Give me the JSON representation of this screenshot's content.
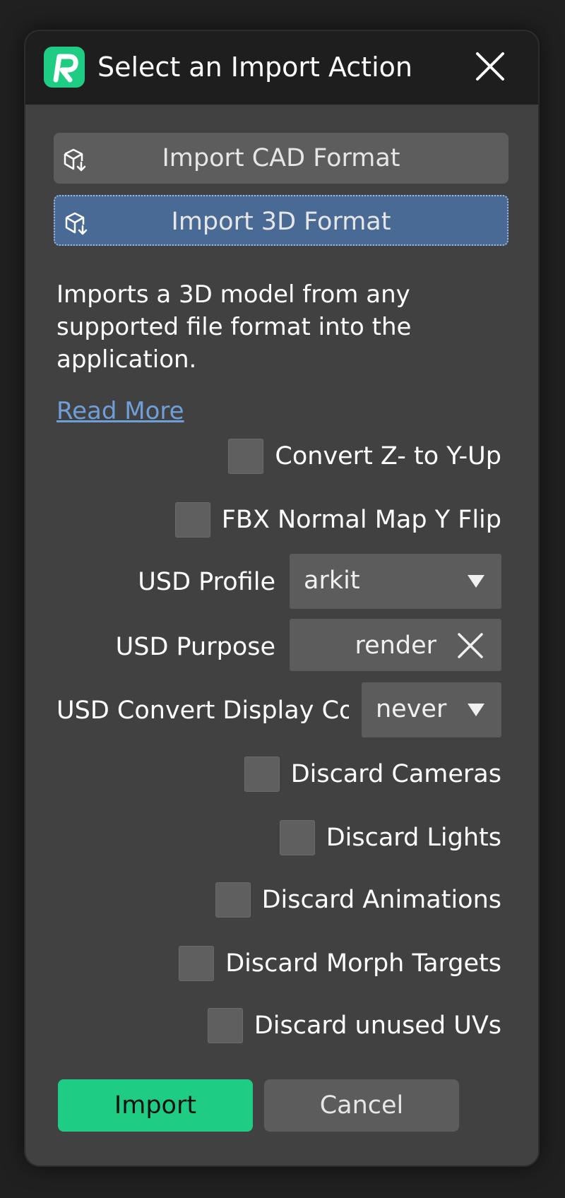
{
  "dialog": {
    "title": "Select an Import Action",
    "logo_letter": "R",
    "accent_color": "#1fcc84",
    "selected_color": "#4a6a96",
    "close_icon": "close-icon"
  },
  "actions": [
    {
      "label": "Import CAD Format",
      "icon": "import-box-icon",
      "selected": false
    },
    {
      "label": "Import 3D Format",
      "icon": "import-box-icon",
      "selected": true
    }
  ],
  "description": {
    "line1": "Imports a 3D model from any",
    "line2": "supported file format into the",
    "line3": "application.",
    "read_more": "Read More"
  },
  "options": {
    "convert_z_to_y": {
      "label": "Convert Z- to Y-Up",
      "checked": false
    },
    "fbx_normal_flip": {
      "label": "FBX Normal Map Y Flip",
      "checked": false
    },
    "usd_profile": {
      "label": "USD Profile",
      "value": "arkit"
    },
    "usd_purpose": {
      "label": "USD Purpose",
      "value": "render"
    },
    "usd_convert_display": {
      "label": "USD Convert Display Co",
      "value": "never"
    },
    "discard_cameras": {
      "label": "Discard Cameras",
      "checked": false
    },
    "discard_lights": {
      "label": "Discard Lights",
      "checked": false
    },
    "discard_animations": {
      "label": "Discard Animations",
      "checked": false
    },
    "discard_morph_targets": {
      "label": "Discard Morph Targets",
      "checked": false
    },
    "discard_unused_uvs": {
      "label": "Discard unused UVs",
      "checked": false
    }
  },
  "buttons": {
    "import": "Import",
    "cancel": "Cancel"
  }
}
